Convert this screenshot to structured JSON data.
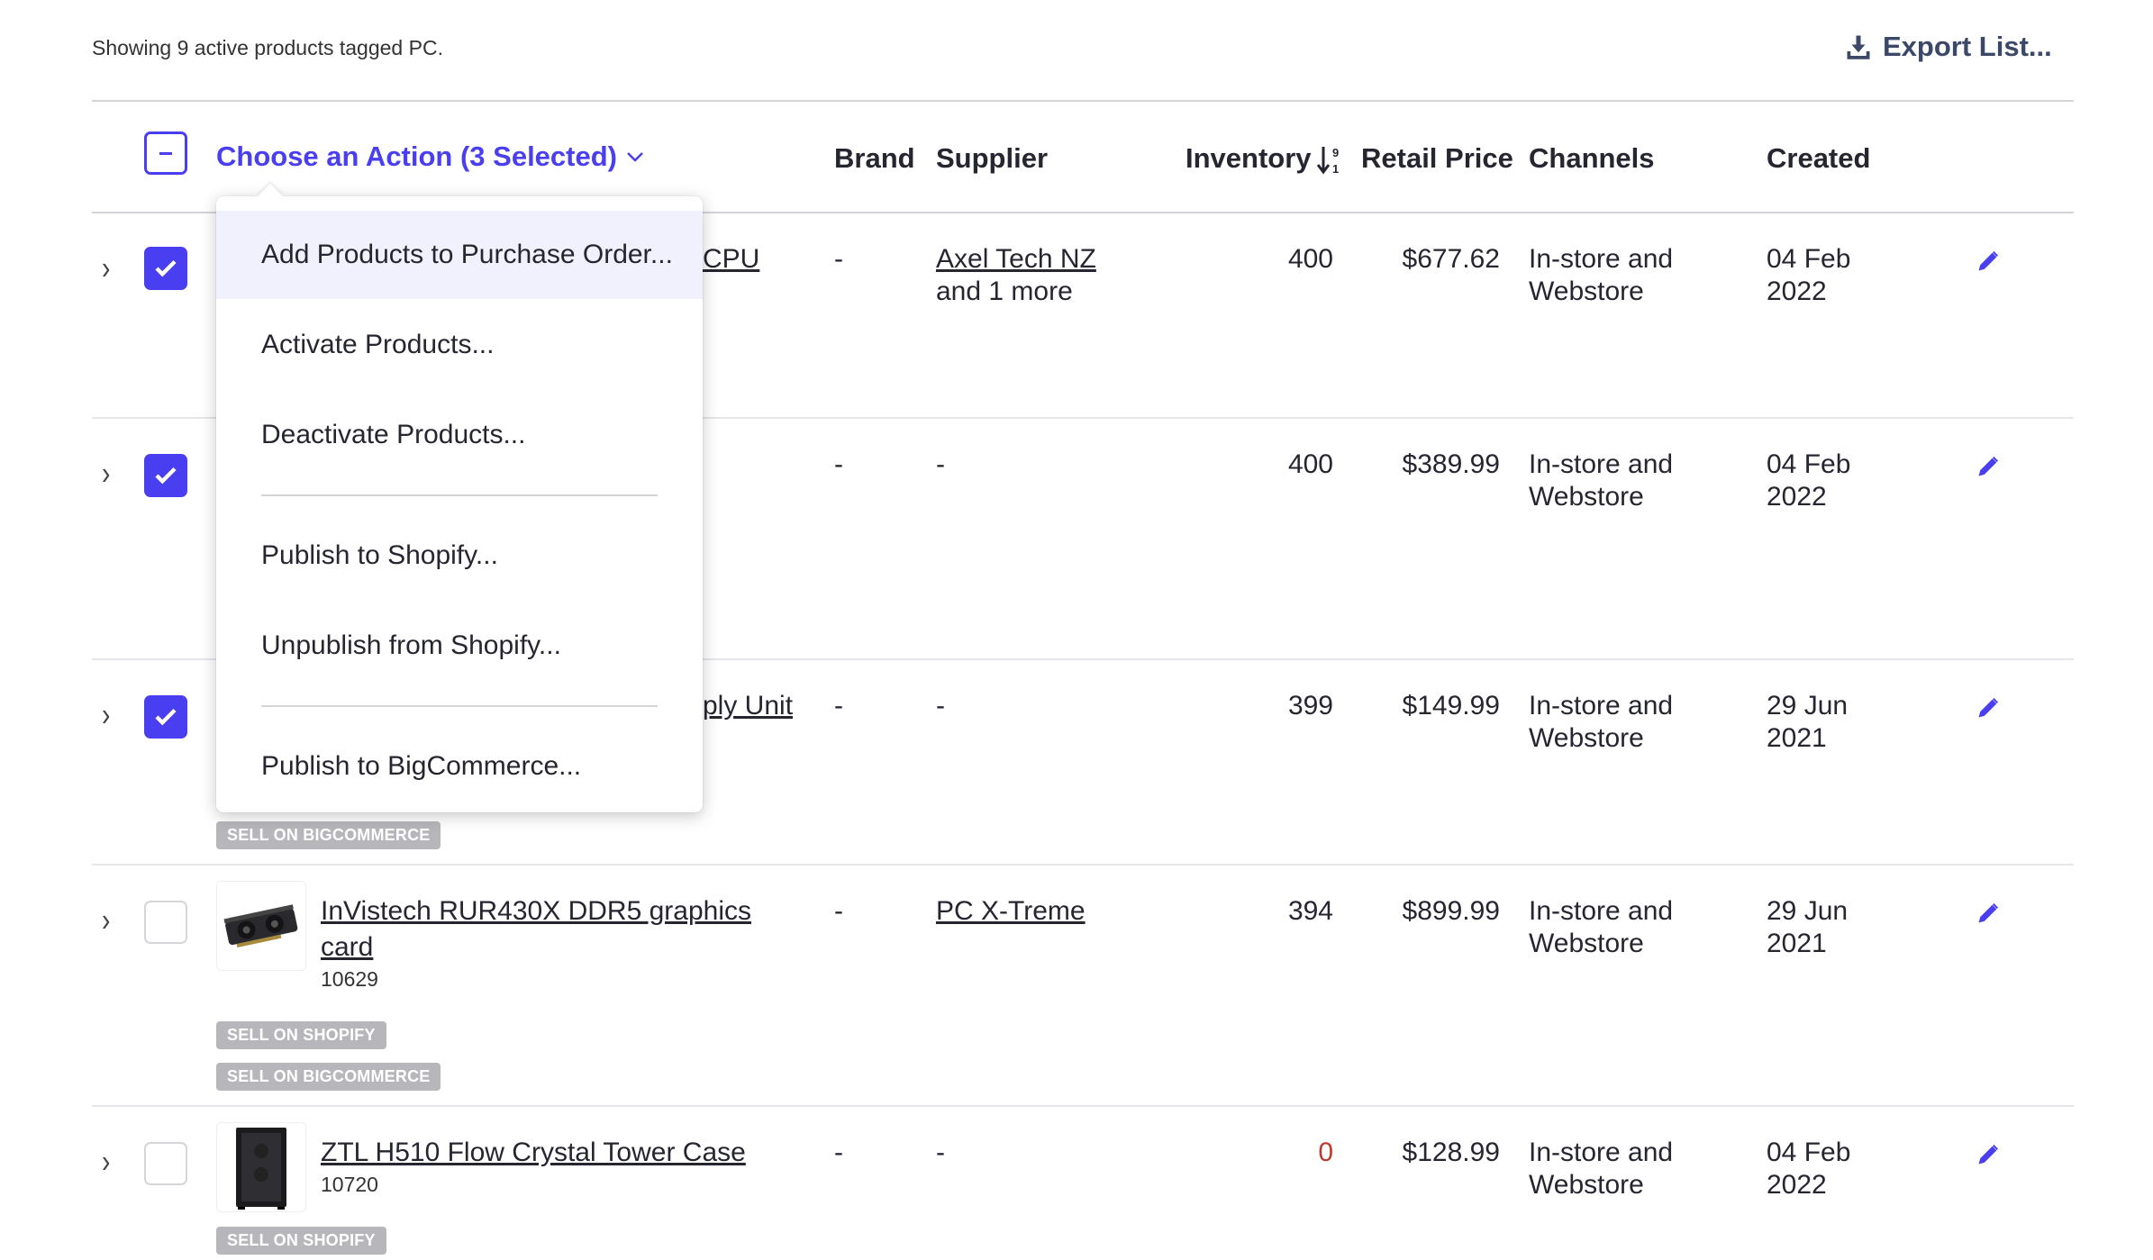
{
  "summary": "Showing 9 active products tagged PC.",
  "export_label": "Export List...",
  "header": {
    "action_label": "Choose an Action (3 Selected)",
    "brand": "Brand",
    "supplier": "Supplier",
    "inventory": "Inventory",
    "retail_price": "Retail Price",
    "channels": "Channels",
    "created": "Created"
  },
  "menu": {
    "items": [
      "Add Products to Purchase Order...",
      "Activate Products...",
      "Deactivate Products...",
      "Publish to Shopify...",
      "Unpublish from Shopify...",
      "Publish to BigCommerce..."
    ]
  },
  "rows": [
    {
      "selected": true,
      "name_visible_fragment": "CPU",
      "brand": "-",
      "supplier": "Axel Tech NZ",
      "supplier_extra": "and 1 more",
      "inventory": "400",
      "price": "$677.62",
      "channels_line1": "In-store and",
      "channels_line2": "Webstore",
      "created_line1": "04 Feb",
      "created_line2": "2022"
    },
    {
      "selected": true,
      "brand": "-",
      "supplier": "-",
      "inventory": "400",
      "price": "$389.99",
      "channels_line1": "In-store and",
      "channels_line2": "Webstore",
      "created_line1": "04 Feb",
      "created_line2": "2022"
    },
    {
      "selected": true,
      "name_visible_fragment": "ply Unit",
      "brand": "-",
      "supplier": "-",
      "inventory": "399",
      "price": "$149.99",
      "channels_line1": "In-store and",
      "channels_line2": "Webstore",
      "created_line1": "29 Jun",
      "created_line2": "2021",
      "badges": [
        "SELL ON BIGCOMMERCE"
      ]
    },
    {
      "selected": false,
      "name_line1": "InVistech RUR430X DDR5 graphics",
      "name_line2": "card",
      "sku": "10629",
      "brand": "-",
      "supplier": "PC X-Treme",
      "inventory": "394",
      "price": "$899.99",
      "channels_line1": "In-store and",
      "channels_line2": "Webstore",
      "created_line1": "29 Jun",
      "created_line2": "2021",
      "badges": [
        "SELL ON SHOPIFY",
        "SELL ON BIGCOMMERCE"
      ]
    },
    {
      "selected": false,
      "name_line1": "ZTL H510 Flow Crystal Tower Case",
      "sku": "10720",
      "brand": "-",
      "supplier": "-",
      "inventory": "0",
      "price": "$128.99",
      "channels_line1": "In-store and",
      "channels_line2": "Webstore",
      "created_line1": "04 Feb",
      "created_line2": "2022",
      "badges": [
        "SELL ON SHOPIFY"
      ]
    }
  ],
  "colors": {
    "accent": "#4a3ff0",
    "export": "#3b4868",
    "badge": "#b7b7bb",
    "out_of_stock": "#c0392b"
  }
}
